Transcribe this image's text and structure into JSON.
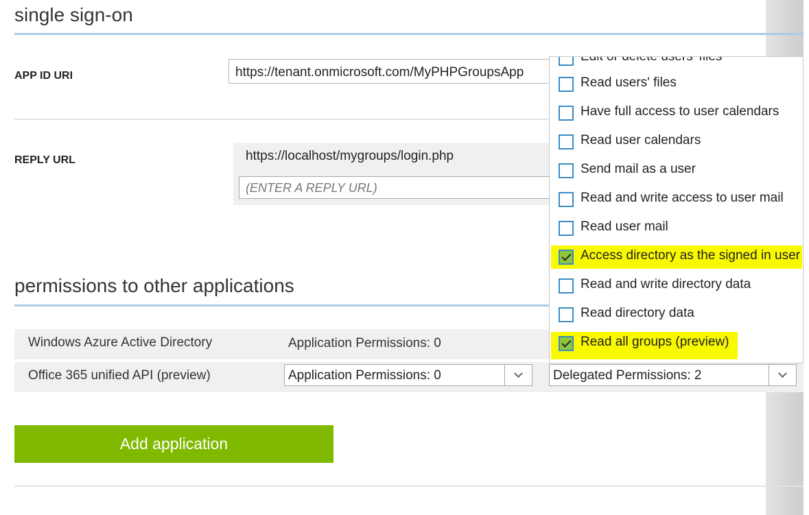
{
  "sso": {
    "title": "single sign-on",
    "app_id_label": "APP ID URI",
    "app_id_value": "https://tenant.onmicrosoft.com/MyPHPGroupsApp",
    "reply_url_label": "REPLY URL",
    "reply_url_value": "https://localhost/mygroups/login.php",
    "reply_url_placeholder": "(ENTER A REPLY URL)"
  },
  "permissions": {
    "title": "permissions to other applications",
    "rows": [
      {
        "name": "Windows Azure Active Directory",
        "application_permissions": "Application Permissions: 0"
      },
      {
        "name": "Office 365 unified API (preview)",
        "application_permissions": "Application Permissions: 0",
        "delegated_permissions": "Delegated Permissions: 2"
      }
    ],
    "add_button": "Add application"
  },
  "delegated_dropdown": {
    "items": [
      {
        "label": "Edit or delete users' files",
        "checked": false,
        "highlighted": false
      },
      {
        "label": "Read users' files",
        "checked": false,
        "highlighted": false
      },
      {
        "label": "Have full access to user calendars",
        "checked": false,
        "highlighted": false
      },
      {
        "label": "Read user calendars",
        "checked": false,
        "highlighted": false
      },
      {
        "label": "Send mail as a user",
        "checked": false,
        "highlighted": false
      },
      {
        "label": "Read and write access to user mail",
        "checked": false,
        "highlighted": false
      },
      {
        "label": "Read user mail",
        "checked": false,
        "highlighted": false
      },
      {
        "label": "Access directory as the signed in user",
        "checked": true,
        "highlighted": true
      },
      {
        "label": "Read and write directory data",
        "checked": false,
        "highlighted": false
      },
      {
        "label": "Read directory data",
        "checked": false,
        "highlighted": false
      },
      {
        "label": "Read all groups (preview)",
        "checked": true,
        "highlighted": true
      }
    ]
  },
  "colors": {
    "accent_blue_rule": "#a9cde8",
    "button_green": "#7fba00",
    "highlight_yellow": "#f9f900",
    "checkbox_border": "#3a8bc7"
  }
}
